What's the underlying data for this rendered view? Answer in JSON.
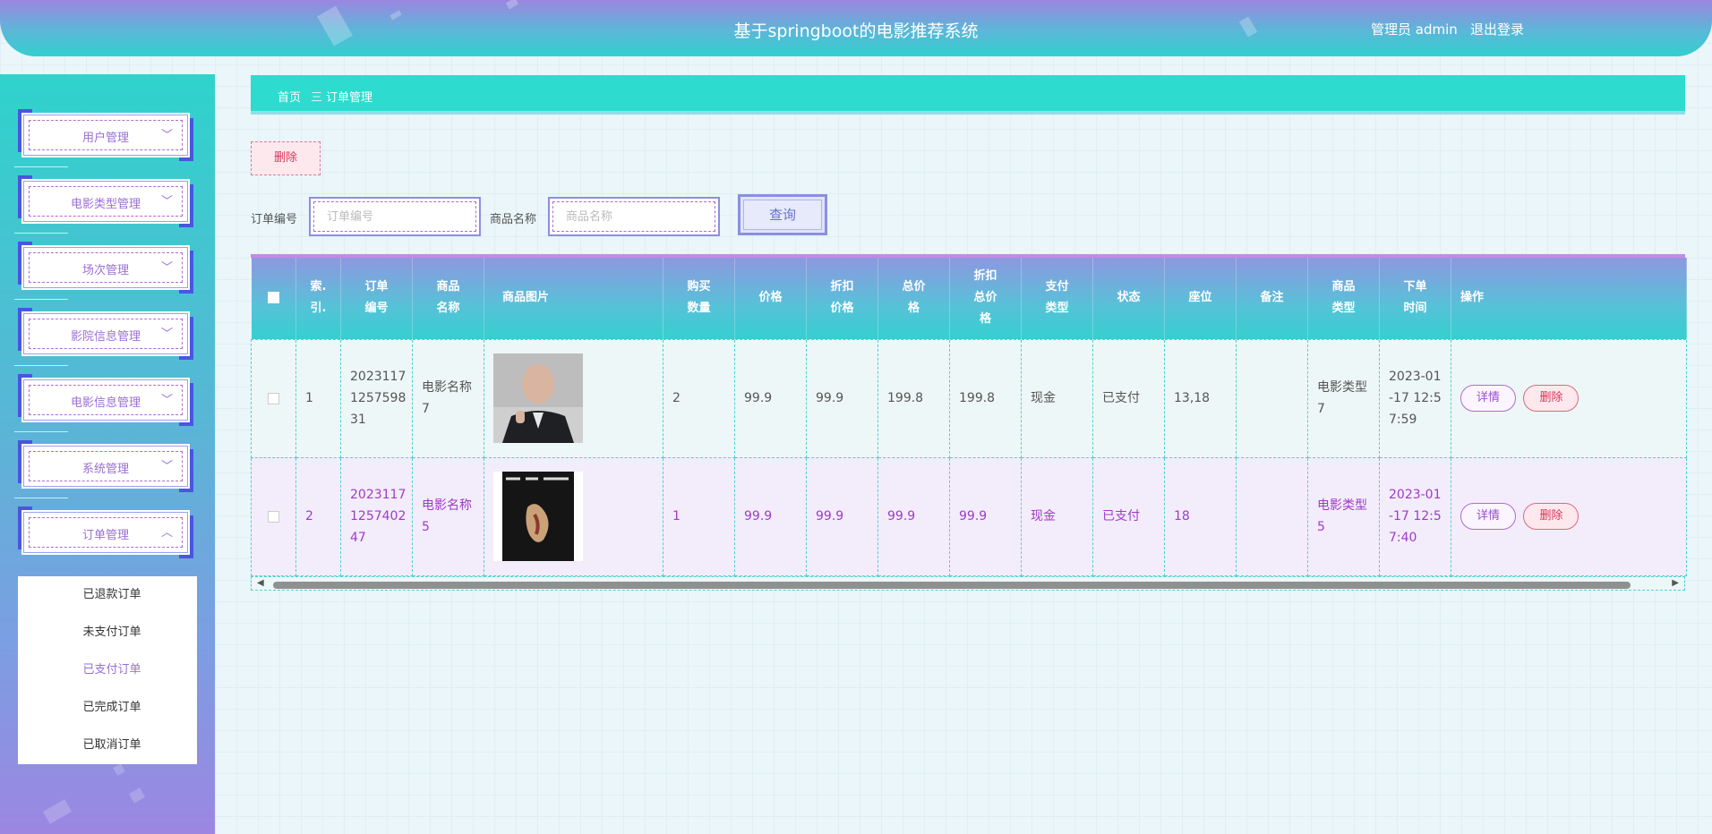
{
  "header": {
    "title": "基于springboot的电影推荐系统",
    "user": "管理员 admin",
    "logout": "退出登录"
  },
  "sidebar": {
    "menus": [
      {
        "label": "用户管理",
        "chevron": "﹀"
      },
      {
        "label": "电影类型管理",
        "chevron": "﹀"
      },
      {
        "label": "场次管理",
        "chevron": "﹀"
      },
      {
        "label": "影院信息管理",
        "chevron": "﹀"
      },
      {
        "label": "电影信息管理",
        "chevron": "﹀"
      },
      {
        "label": "系统管理",
        "chevron": "﹀"
      },
      {
        "label": "订单管理",
        "chevron": "︿"
      }
    ],
    "submenu": [
      "已退款订单",
      "未支付订单",
      "已支付订单",
      "已完成订单",
      "已取消订单"
    ],
    "active_submenu": "已支付订单"
  },
  "breadcrumb": {
    "home": "首页",
    "sep": "三",
    "current": "订单管理"
  },
  "toolbar": {
    "delete": "删除"
  },
  "filters": {
    "order_label": "订单编号",
    "order_placeholder": "订单编号",
    "goods_label": "商品名称",
    "goods_placeholder": "商品名称",
    "query": "查询"
  },
  "table": {
    "headers": [
      "索.\n引.",
      "订单\n编号",
      "商品\n名称",
      "商品图片",
      "购买\n数量",
      "价格",
      "折扣\n价格",
      "总价\n格",
      "折扣\n总价\n格",
      "支付\n类型",
      "状态",
      "座位",
      "备注",
      "商品\n类型",
      "下单\n时间",
      "操作"
    ],
    "rows": [
      {
        "index": "1",
        "order_no": "2023117\n1257598\n31",
        "goods": "电影名称\n7",
        "qty": "2",
        "price": "99.9",
        "disc_price": "99.9",
        "total": "199.8",
        "disc_total": "199.8",
        "pay": "现金",
        "status": "已支付",
        "seat": "13,18",
        "remark": "",
        "type": "电影类型\n7",
        "time": "2023-01\n-17 12:5\n7:59",
        "detail": "详情",
        "delete": "删除"
      },
      {
        "index": "2",
        "order_no": "2023117\n1257402\n47",
        "goods": "电影名称\n5",
        "qty": "1",
        "price": "99.9",
        "disc_price": "99.9",
        "total": "99.9",
        "disc_total": "99.9",
        "pay": "现金",
        "status": "已支付",
        "seat": "18",
        "remark": "",
        "type": "电影类型\n5",
        "time": "2023-01\n-17 12:5\n7:40",
        "detail": "详情",
        "delete": "删除"
      }
    ]
  },
  "colors": {
    "accent": "#2ddccf",
    "purple": "#9a6fd4",
    "danger": "#d9365a"
  }
}
